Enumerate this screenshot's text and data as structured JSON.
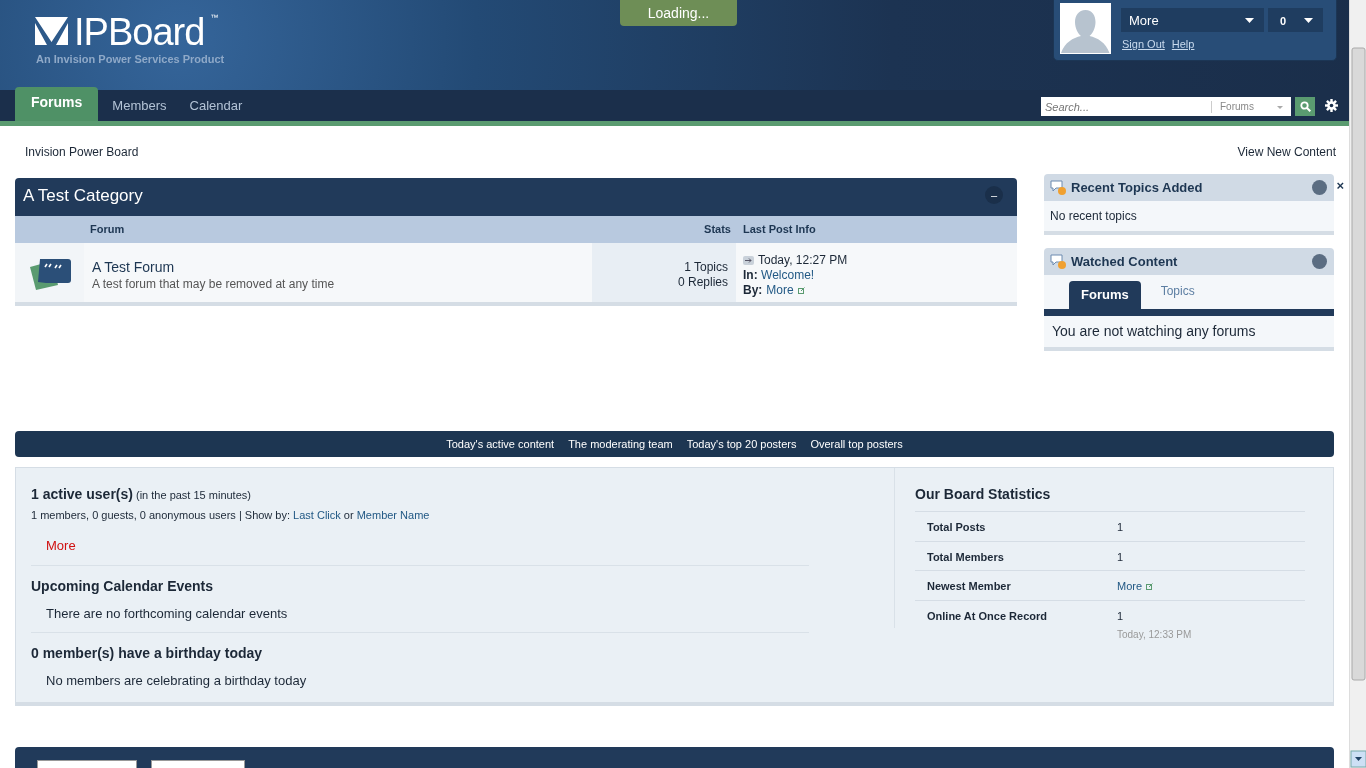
{
  "header": {
    "logo_text": "IPBoard",
    "trademark": "™",
    "tagline": "An Invision Power Services Product",
    "loading": "Loading..."
  },
  "user_bar": {
    "menu": "More",
    "notifications": "0",
    "links": [
      "Sign Out",
      "Help"
    ]
  },
  "nav": {
    "tabs": [
      {
        "label": "Forums",
        "selected": true
      },
      {
        "label": "Members",
        "selected": false
      },
      {
        "label": "Calendar",
        "selected": false
      }
    ],
    "search": {
      "placeholder": "Search...",
      "scope": "Forums"
    }
  },
  "breadcrumb": "Invision Power Board",
  "view_new": "View New Content",
  "category": {
    "title": "A Test Category",
    "collapse": "–",
    "columns": [
      "Forum",
      "Stats",
      "Last Post Info"
    ],
    "forums": [
      {
        "name": "A Test Forum",
        "description": "A test forum that may be removed at any time",
        "topics": "1 Topics",
        "replies": "0 Replies",
        "last_post_time": "Today, 12:27 PM",
        "in_label": "In:",
        "in_topic": "Welcome!",
        "by_label": "By:",
        "by_user": "More"
      }
    ]
  },
  "sidebar": [
    {
      "title": "Recent Topics Added",
      "close": "×",
      "body": "No recent topics"
    },
    {
      "title": "Watched Content",
      "tabs": [
        {
          "label": "Forums",
          "selected": true
        },
        {
          "label": "Topics",
          "selected": false
        }
      ],
      "body": "You are not watching any forums"
    }
  ],
  "quick_links": [
    "Today's active content",
    "The moderating team",
    "Today's top 20 posters",
    "Overall top posters"
  ],
  "active_users": {
    "title": "1 active user(s)",
    "period": "(in the past 15 minutes)",
    "summary": "1 members, 0 guests, 0 anonymous users | Show by: ",
    "sort_links": [
      "Last Click",
      "Member Name"
    ],
    "sort_joiner": " or ",
    "users": [
      "More"
    ]
  },
  "calendar": {
    "title": "Upcoming Calendar Events",
    "body": "There are no forthcoming calendar events"
  },
  "birthdays": {
    "title": "0 member(s) have a birthday today",
    "body": "No members are celebrating a birthday today"
  },
  "board_stats": {
    "title": "Our Board Statistics",
    "rows": [
      {
        "label": "Total Posts",
        "value": "1",
        "kind": "text"
      },
      {
        "label": "Total Members",
        "value": "1",
        "kind": "text"
      },
      {
        "label": "Newest Member",
        "value": "More",
        "kind": "link"
      },
      {
        "label": "Online At Once Record",
        "value": "1",
        "note": "Today, 12:33 PM",
        "kind": "text"
      }
    ]
  }
}
